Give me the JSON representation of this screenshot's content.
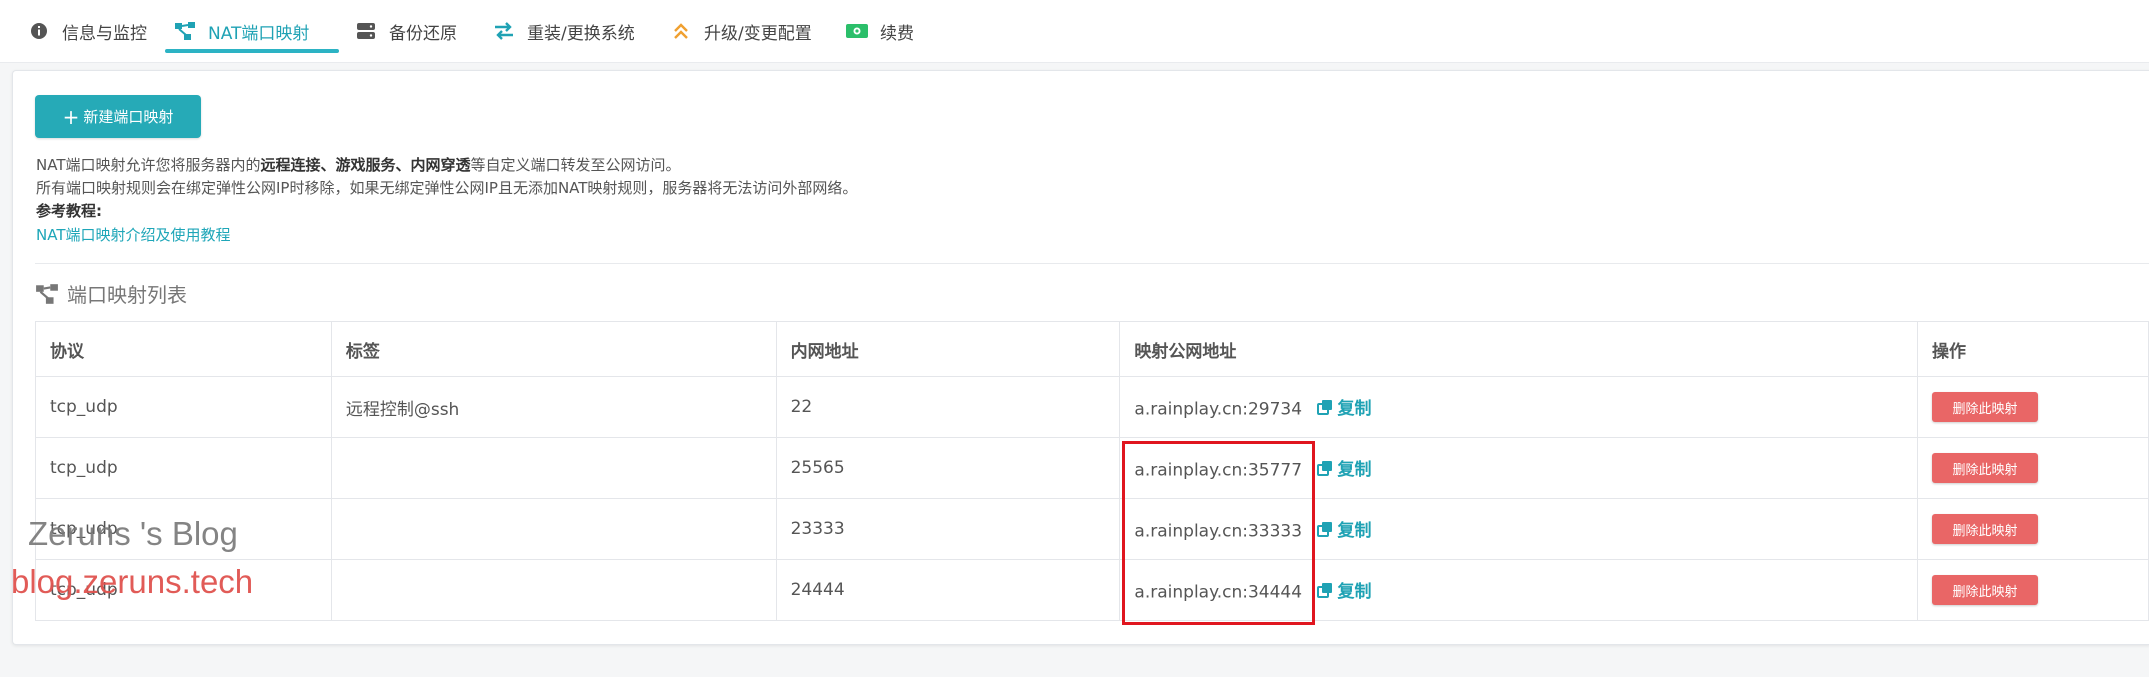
{
  "tabs": [
    {
      "label": "信息与监控",
      "icon": "info-icon"
    },
    {
      "label": "NAT端口映射",
      "icon": "network-icon"
    },
    {
      "label": "备份还原",
      "icon": "database-icon"
    },
    {
      "label": "重装/更换系统",
      "icon": "swap-arrows-icon"
    },
    {
      "label": "升级/变更配置",
      "icon": "double-chevron-up-icon"
    },
    {
      "label": "续费",
      "icon": "money-icon"
    }
  ],
  "active_tab": "NAT端口映射",
  "toolbar": {
    "new_button_label": "新建端口映射"
  },
  "description": {
    "line1_pre": "NAT端口映射允许您将服务器内的",
    "line1_bold": "远程连接、游戏服务、内网穿透",
    "line1_post": "等自定义端口转发至公网访问。",
    "line2": "所有端口映射规则会在绑定弹性公网IP时移除，如果无绑定弹性公网IP且无添加NAT映射规则，服务器将无法访问外部网络。",
    "ref_label": "参考教程:",
    "tutorial_link": "NAT端口映射介绍及使用教程"
  },
  "section": {
    "title": "端口映射列表",
    "icon": "network-icon"
  },
  "table": {
    "columns": [
      "协议",
      "标签",
      "内网地址",
      "映射公网地址",
      "操作"
    ],
    "rows": [
      {
        "protocol": "tcp_udp",
        "tag": "远程控制@ssh",
        "internal": "22",
        "public": "a.rainplay.cn:29734"
      },
      {
        "protocol": "tcp_udp",
        "tag": "",
        "internal": "25565",
        "public": "a.rainplay.cn:35777"
      },
      {
        "protocol": "tcp_udp",
        "tag": "",
        "internal": "23333",
        "public": "a.rainplay.cn:33333"
      },
      {
        "protocol": "tcp_udp",
        "tag": "",
        "internal": "24444",
        "public": "a.rainplay.cn:34444"
      }
    ],
    "copy_label": "复制",
    "delete_label": "删除此映射"
  },
  "watermark": {
    "line1": "Zeruns 's Blog",
    "line2": "blog.zeruns.tech"
  },
  "colors": {
    "accent": "#26aab7",
    "danger": "#e96666",
    "highlight": "#e0161f",
    "watermark_red": "#e0534f"
  }
}
